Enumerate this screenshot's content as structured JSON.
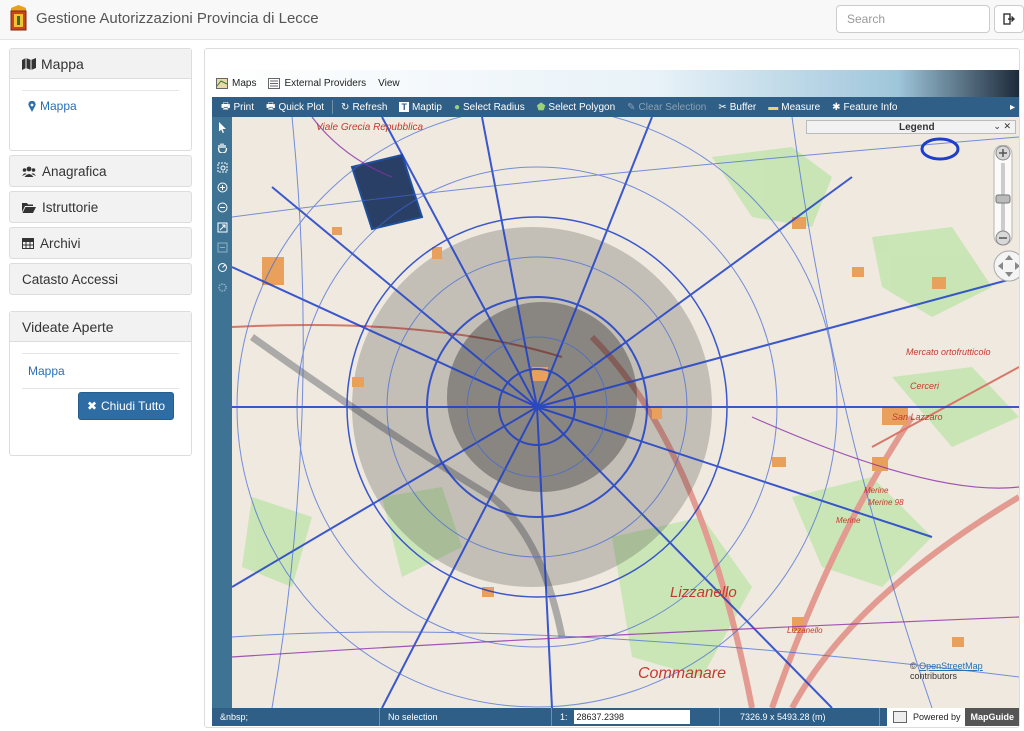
{
  "app": {
    "title": "Gestione Autorizzazioni Provincia di Lecce"
  },
  "search": {
    "placeholder": "Search"
  },
  "sidebar": {
    "mappa_panel": {
      "title": "Mappa",
      "link": "Mappa"
    },
    "items": [
      {
        "label": "Anagrafica",
        "icon": "users-icon"
      },
      {
        "label": "Istruttorie",
        "icon": "folder-open-icon"
      },
      {
        "label": "Archivi",
        "icon": "table-icon"
      },
      {
        "label": "Catasto Accessi",
        "icon": ""
      }
    ],
    "open_views": {
      "title": "Videate Aperte",
      "link": "Mappa",
      "close_all": "Chiudi Tutto"
    }
  },
  "viewer": {
    "menu": [
      "Maps",
      "External Providers",
      "View"
    ],
    "toolbar": [
      {
        "label": "Print",
        "enabled": true
      },
      {
        "label": "Quick Plot",
        "enabled": true
      },
      {
        "label": "Refresh",
        "enabled": true
      },
      {
        "label": "Maptip",
        "enabled": true
      },
      {
        "label": "Select Radius",
        "enabled": true
      },
      {
        "label": "Select Polygon",
        "enabled": true
      },
      {
        "label": "Clear Selection",
        "enabled": false
      },
      {
        "label": "Buffer",
        "enabled": true
      },
      {
        "label": "Measure",
        "enabled": true
      },
      {
        "label": "Feature Info",
        "enabled": true
      }
    ],
    "legend": {
      "title": "Legend"
    },
    "map_labels": [
      "Viale Grecia Repubblica",
      "Lizzanello",
      "Lizzanello",
      "Commanare",
      "Mercato ortofrutticolo",
      "Cerceri",
      "San Lazzaro",
      "Merine",
      "Merine",
      "Merine 98"
    ],
    "attribution": {
      "prefix": "©",
      "link": "OpenStreetMap",
      "suffix": "contributors"
    },
    "status": {
      "field1": "&nbsp;",
      "selection": "No selection",
      "scale_prefix": "1:",
      "scale": "28637.2398",
      "extent": "7326.9 x 5493.28 (m)",
      "powered_by": "Powered by",
      "brand": "MapGuide"
    }
  },
  "colors": {
    "toolbar": "#2f5f86",
    "primary_button": "#2e6da4",
    "link": "#2a6fb0"
  }
}
